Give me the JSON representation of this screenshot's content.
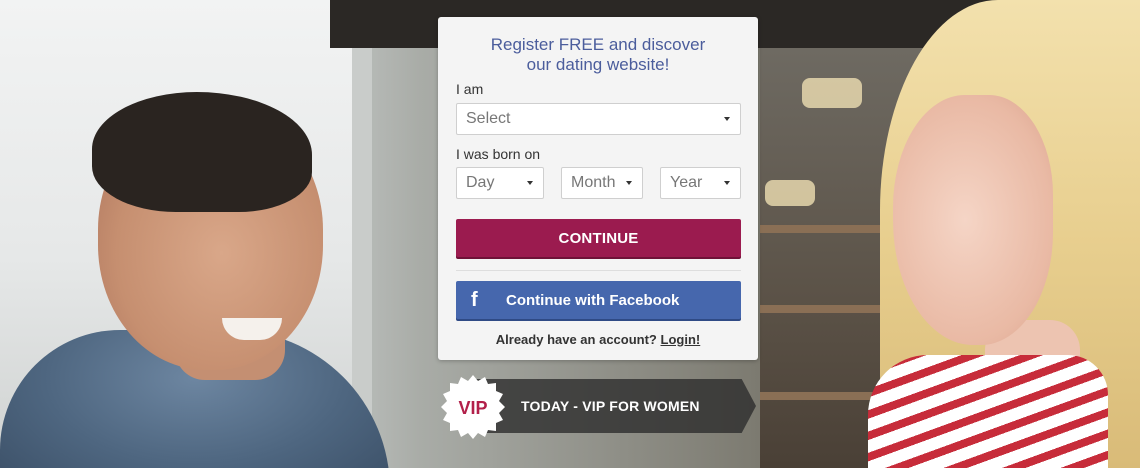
{
  "form": {
    "title_line1": "Register FREE and discover",
    "title_line2": "our dating website!",
    "i_am_label": "I am",
    "i_am_value": "Select",
    "born_label": "I was born on",
    "day_value": "Day",
    "month_value": "Month",
    "year_value": "Year",
    "continue_label": "CONTINUE",
    "facebook_label": "Continue with Facebook",
    "facebook_icon_glyph": "f",
    "account_text": "Already have an account?",
    "login_label": "Login!"
  },
  "vip": {
    "badge_text": "VIP",
    "banner_text": "TODAY - VIP FOR WOMEN"
  },
  "colors": {
    "title": "#4b5d9c",
    "continue_button": "#9b1b4f",
    "facebook_button": "#4667ad",
    "vip_badge_text": "#b2204a"
  },
  "icons": {
    "select_caret": "caret-down-icon",
    "facebook": "facebook-icon",
    "vip_badge": "vip-badge-icon"
  }
}
